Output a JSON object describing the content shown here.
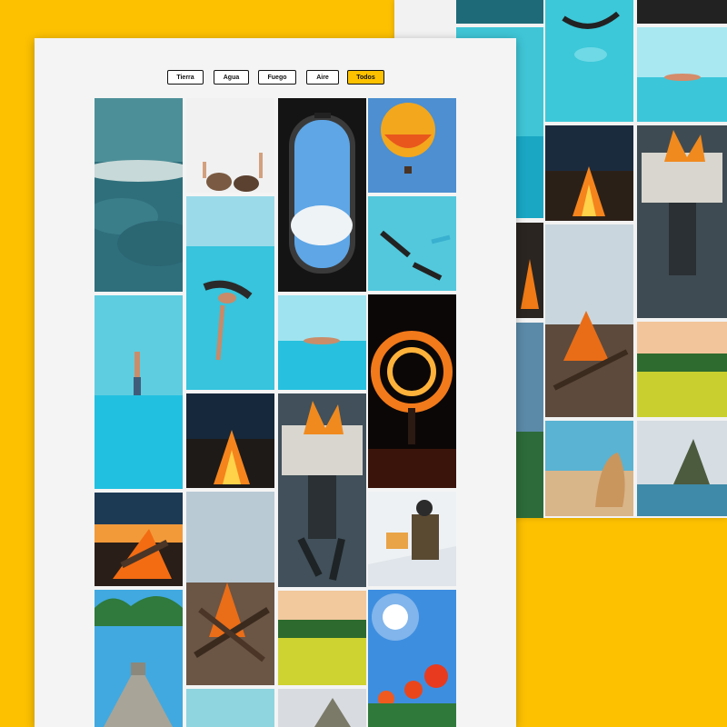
{
  "filters": [
    {
      "label": "Tierra",
      "active": false
    },
    {
      "label": "Agua",
      "active": false
    },
    {
      "label": "Fuego",
      "active": false
    },
    {
      "label": "Aire",
      "active": false
    },
    {
      "label": "Todos",
      "active": true
    }
  ],
  "photos": [
    {
      "id": "storm-clouds",
      "icon": "clouds-photo"
    },
    {
      "id": "hands-sky",
      "icon": "people-photo"
    },
    {
      "id": "airplane-window",
      "icon": "airplane-window-photo"
    },
    {
      "id": "hot-air-balloon",
      "icon": "balloon-photo"
    },
    {
      "id": "underwater-swimmer",
      "icon": "swimmer-photo"
    },
    {
      "id": "snorkelers",
      "icon": "snorkel-photo"
    },
    {
      "id": "infinity-pool-man",
      "icon": "pool-photo"
    },
    {
      "id": "pool-floater",
      "icon": "pool-photo"
    },
    {
      "id": "fire-spinner",
      "icon": "fire-photo"
    },
    {
      "id": "campfire-night",
      "icon": "fire-photo"
    },
    {
      "id": "burning-newspaper",
      "icon": "newspaper-photo"
    },
    {
      "id": "bonfire-sunset",
      "icon": "fire-photo"
    },
    {
      "id": "campfire-logs",
      "icon": "fire-photo"
    },
    {
      "id": "snow-reader",
      "icon": "snow-photo"
    },
    {
      "id": "yellow-flower-field",
      "icon": "field-photo"
    },
    {
      "id": "mayan-pyramid",
      "icon": "pyramid-photo"
    },
    {
      "id": "poppies-sun",
      "icon": "poppy-photo"
    }
  ],
  "colors": {
    "background": "#fdc100",
    "page": "#f4f4f4",
    "active_filter": "#fdc100",
    "border": "#111111"
  }
}
